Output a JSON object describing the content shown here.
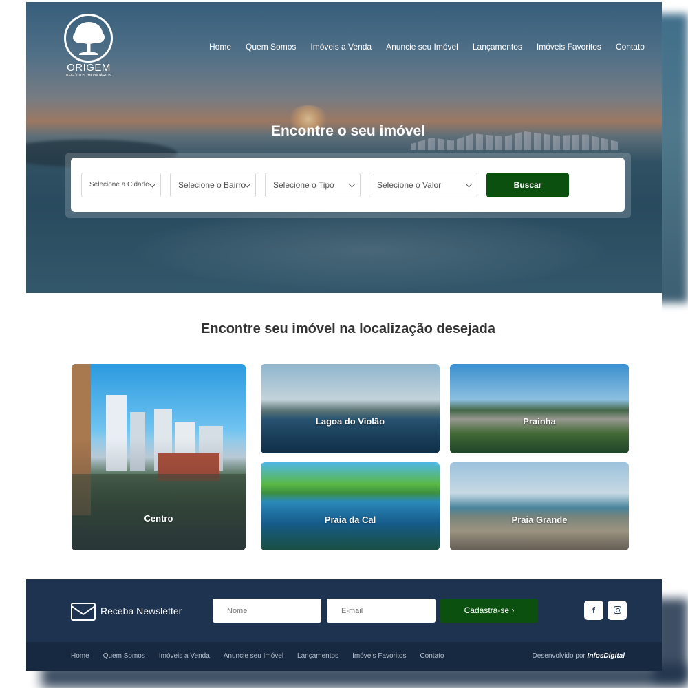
{
  "brand": {
    "name": "ORIGEM",
    "tagline": "NEGÓCIOS IMOBILIÁRIOS"
  },
  "nav": [
    "Home",
    "Quem Somos",
    "Imóveis a Venda",
    "Anuncie seu Imóvel",
    "Lançamentos",
    "Imóveis Favoritos",
    "Contato"
  ],
  "hero": {
    "title": "Encontre o seu imóvel"
  },
  "search": {
    "city": "Selecione a Cidade",
    "neighborhood": "Selecione o Bairro",
    "type": "Selecione o Tipo",
    "price": "Selecione o Valor",
    "button": "Buscar"
  },
  "locations": {
    "title": "Encontre seu imóvel na localização desejada",
    "items": [
      "Centro",
      "Lagoa do Violão",
      "Prainha",
      "Praia da Cal",
      "Praia Grande"
    ]
  },
  "newsletter": {
    "title": "Receba Newsletter",
    "name_placeholder": "Nome",
    "email_placeholder": "E-mail",
    "button": "Cadastra-se ›"
  },
  "social": {
    "facebook": "f"
  },
  "footer": {
    "links": [
      "Home",
      "Quem Somos",
      "Imóveis a Venda",
      "Anuncie seu Imóvel",
      "Lançamentos",
      "Imóveis Favoritos",
      "Contato"
    ],
    "credit_prefix": "Desenvolvido por",
    "credit_brand": "InfosDigital"
  },
  "colors": {
    "primary_green": "#0c5010",
    "footer_navy": "#1e3350",
    "footer_bar": "#172941"
  }
}
